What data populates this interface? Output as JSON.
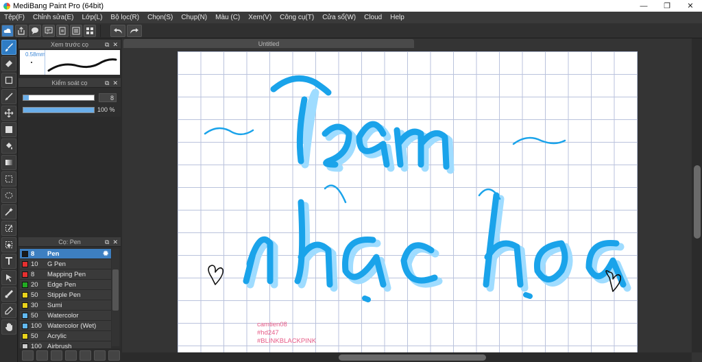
{
  "window": {
    "title": "MediBang Paint Pro (64bit)",
    "minimize": "—",
    "restore": "❐",
    "close": "✕"
  },
  "menu": [
    "Tệp(F)",
    "Chỉnh sửa(E)",
    "Lớp(L)",
    "Bộ lọc(R)",
    "Chọn(S)",
    "Chụp(N)",
    "Màu (C)",
    "Xem(V)",
    "Công cụ(T)",
    "Cửa sổ(W)",
    "Cloud",
    "Help"
  ],
  "panels": {
    "brush_preview": {
      "title": "Xem trước cọ",
      "size": "0.58mm"
    },
    "brush_control": {
      "title": "Kiểm soát cọ",
      "size_value": "8",
      "size_fraction": 0.08,
      "opacity_value": "100 %",
      "opacity_fraction": 1.0
    },
    "brush_list": {
      "title": "Cọ: Pen",
      "items": [
        {
          "size": "8",
          "name": "Pen",
          "color": "#1a1a1a",
          "selected": true
        },
        {
          "size": "10",
          "name": "G Pen",
          "color": "#e53030"
        },
        {
          "size": "8",
          "name": "Mapping Pen",
          "color": "#e53030"
        },
        {
          "size": "20",
          "name": "Edge Pen",
          "color": "#22aa22"
        },
        {
          "size": "50",
          "name": "Stipple Pen",
          "color": "#e8d21c"
        },
        {
          "size": "30",
          "name": "Sumi",
          "color": "#e8d21c"
        },
        {
          "size": "50",
          "name": "Watercolor",
          "color": "#62b8ee"
        },
        {
          "size": "100",
          "name": "Watercolor (Wet)",
          "color": "#62b8ee"
        },
        {
          "size": "50",
          "name": "Acrylic",
          "color": "#e8d21c"
        },
        {
          "size": "100",
          "name": "Airbrush",
          "color": "#cccccc"
        }
      ]
    }
  },
  "document": {
    "tab": "Untitled",
    "canvas_text": [
      "camtien08",
      "#hd247",
      "#BLINKBLACKPINK"
    ],
    "lettering_lines": [
      "Team",
      "nhạc họa"
    ],
    "ink_color": "#1aa3ea",
    "shadow_color": "#9fdcff",
    "grid_color": "#b9c2dc"
  }
}
